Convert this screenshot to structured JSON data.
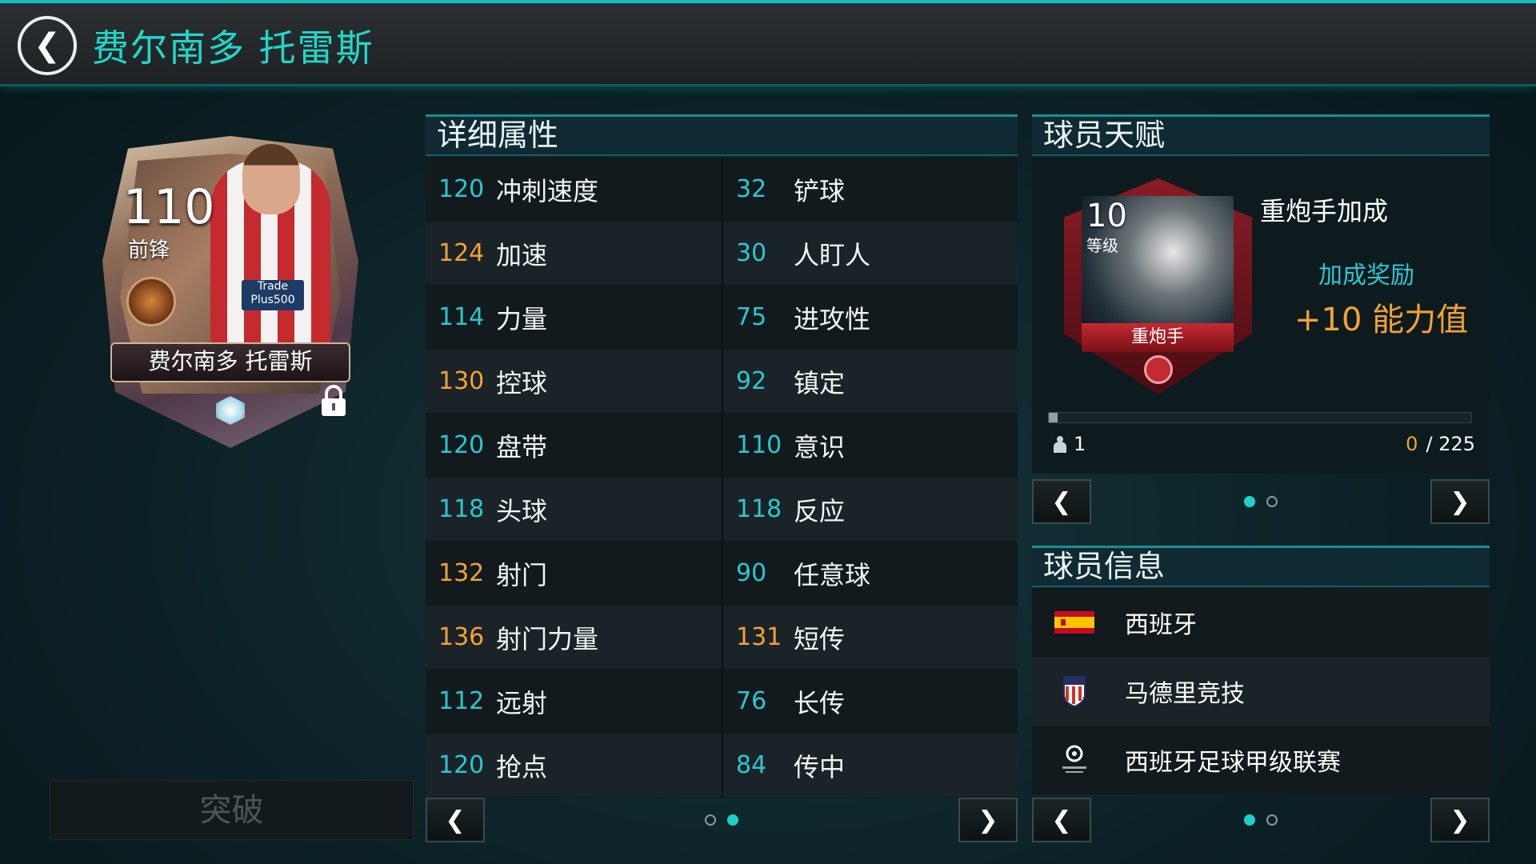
{
  "header": {
    "title": "费尔南多 托雷斯"
  },
  "card": {
    "rating": "110",
    "position": "前锋",
    "name": "费尔南多 托雷斯",
    "sponsor_line1": "Trade",
    "sponsor_line2": "Plus500"
  },
  "breakthrough_label": "突破",
  "attributes": {
    "title": "详细属性",
    "rows": [
      {
        "left": {
          "value": "120",
          "name": "冲刺速度",
          "color": "teal"
        },
        "right": {
          "value": "32",
          "name": "铲球",
          "color": "teal"
        }
      },
      {
        "left": {
          "value": "124",
          "name": "加速",
          "color": "orange"
        },
        "right": {
          "value": "30",
          "name": "人盯人",
          "color": "teal"
        }
      },
      {
        "left": {
          "value": "114",
          "name": "力量",
          "color": "teal"
        },
        "right": {
          "value": "75",
          "name": "进攻性",
          "color": "teal"
        }
      },
      {
        "left": {
          "value": "130",
          "name": "控球",
          "color": "orange"
        },
        "right": {
          "value": "92",
          "name": "镇定",
          "color": "teal"
        }
      },
      {
        "left": {
          "value": "120",
          "name": "盘带",
          "color": "teal"
        },
        "right": {
          "value": "110",
          "name": "意识",
          "color": "teal"
        }
      },
      {
        "left": {
          "value": "118",
          "name": "头球",
          "color": "teal"
        },
        "right": {
          "value": "118",
          "name": "反应",
          "color": "teal"
        }
      },
      {
        "left": {
          "value": "132",
          "name": "射门",
          "color": "orange"
        },
        "right": {
          "value": "90",
          "name": "任意球",
          "color": "teal"
        }
      },
      {
        "left": {
          "value": "136",
          "name": "射门力量",
          "color": "orange"
        },
        "right": {
          "value": "131",
          "name": "短传",
          "color": "orange"
        }
      },
      {
        "left": {
          "value": "112",
          "name": "远射",
          "color": "teal"
        },
        "right": {
          "value": "76",
          "name": "长传",
          "color": "teal"
        }
      },
      {
        "left": {
          "value": "120",
          "name": "抢点",
          "color": "teal"
        },
        "right": {
          "value": "84",
          "name": "传中",
          "color": "teal"
        }
      }
    ],
    "page": 2,
    "page_count": 2
  },
  "talent": {
    "title": "球员天赋",
    "level": "10",
    "level_label": "等级",
    "badge_label": "重炮手",
    "name": "重炮手加成",
    "bonus_label": "加成奖励",
    "bonus_value": "+10 能力值",
    "count": "1",
    "progress_current": "0",
    "progress_sep": "/",
    "progress_total": "225",
    "progress_fraction": 0.0,
    "page": 1,
    "page_count": 2
  },
  "info": {
    "title": "球员信息",
    "nation": "西班牙",
    "club": "马德里竞技",
    "league": "西班牙足球甲级联赛",
    "page": 1,
    "page_count": 2
  },
  "colors": {
    "teal": "#2cc7d0",
    "orange": "#f4a233",
    "accent": "#1ed0c8"
  }
}
